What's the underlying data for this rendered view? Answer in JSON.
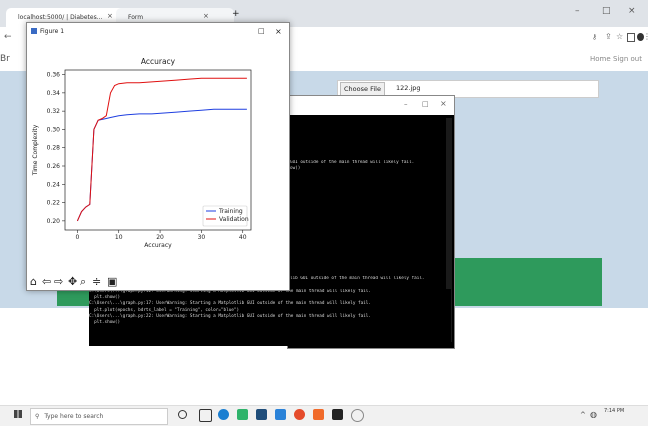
{
  "browser": {
    "tabs": [
      {
        "label": "localhost:5000/ | Diabetes...",
        "close": "×"
      },
      {
        "label": "Form",
        "close": "×"
      }
    ],
    "new_tab": "+",
    "window_controls": {
      "minimize": "–",
      "maximize": "□",
      "close": "×"
    },
    "left_partial": "Br"
  },
  "webpage": {
    "nav": {
      "home": "Home",
      "signout": "Sign out"
    },
    "file": {
      "button": "Choose File",
      "filename": "122.jpg"
    }
  },
  "figure_window": {
    "title": "Figure 1",
    "controls": {
      "maximize": "□",
      "close": "×"
    },
    "toolbar_icons": [
      "home-icon",
      "back-icon",
      "forward-icon",
      "pan-icon",
      "zoom-icon",
      "configure-icon",
      "save-icon"
    ]
  },
  "console": {
    "controls": {
      "minimize": "–",
      "maximize": "□",
      "close": "×"
    },
    "upper_lines": [
      "GUI outside of the main thread will likely fail.",
      "ow()"
    ],
    "mid_line": "lib GUI outside of the main thread will likely fail.",
    "lines": [
      "C:\\Users\\...\\graph.py:12: UserWarning: Starting a Matplotlib GUI outside of the main thread will likely fail.",
      "  plt.show()",
      "C:\\Users\\...\\graph.py:17: UserWarning: Starting a Matplotlib GUI outside of the main thread will likely fail.",
      "  plt.plot(epochs, bdrts_label = \"Training\", color=\"blue\")",
      "C:\\Users\\...\\graph.py:22: UserWarning: Starting a Matplotlib GUI outside of the main thread will likely fail.",
      "  plt.show()"
    ]
  },
  "taskbar": {
    "search_placeholder": "Type here to search",
    "time": "7:14 PM"
  },
  "chart_data": {
    "type": "line",
    "title": "Accuracy",
    "xlabel": "Accuracy",
    "ylabel": "Time Complexity",
    "xlim": [
      -3,
      42
    ],
    "ylim": [
      0.19,
      0.365
    ],
    "xticks": [
      0,
      10,
      20,
      30,
      40
    ],
    "yticks": [
      0.2,
      0.22,
      0.24,
      0.26,
      0.28,
      0.3,
      0.32,
      0.34,
      0.36
    ],
    "legend_position": "lower-right",
    "series": [
      {
        "name": "Training",
        "color": "#1f3fe0",
        "x": [
          0,
          1,
          2,
          3,
          4,
          5,
          6,
          7,
          8,
          10,
          12,
          15,
          18,
          21,
          24,
          27,
          30,
          33,
          36,
          41
        ],
        "y": [
          0.2,
          0.21,
          0.215,
          0.218,
          0.3,
          0.31,
          0.311,
          0.312,
          0.313,
          0.315,
          0.316,
          0.317,
          0.317,
          0.318,
          0.319,
          0.32,
          0.321,
          0.322,
          0.322,
          0.322
        ]
      },
      {
        "name": "Validation",
        "color": "#e01010",
        "x": [
          0,
          1,
          2,
          3,
          4,
          5,
          6,
          7,
          8,
          9,
          10,
          12,
          15,
          18,
          21,
          24,
          27,
          30,
          33,
          36,
          41
        ],
        "y": [
          0.2,
          0.21,
          0.215,
          0.218,
          0.3,
          0.31,
          0.312,
          0.315,
          0.34,
          0.348,
          0.35,
          0.351,
          0.351,
          0.352,
          0.353,
          0.354,
          0.355,
          0.356,
          0.356,
          0.356,
          0.356
        ]
      }
    ]
  }
}
